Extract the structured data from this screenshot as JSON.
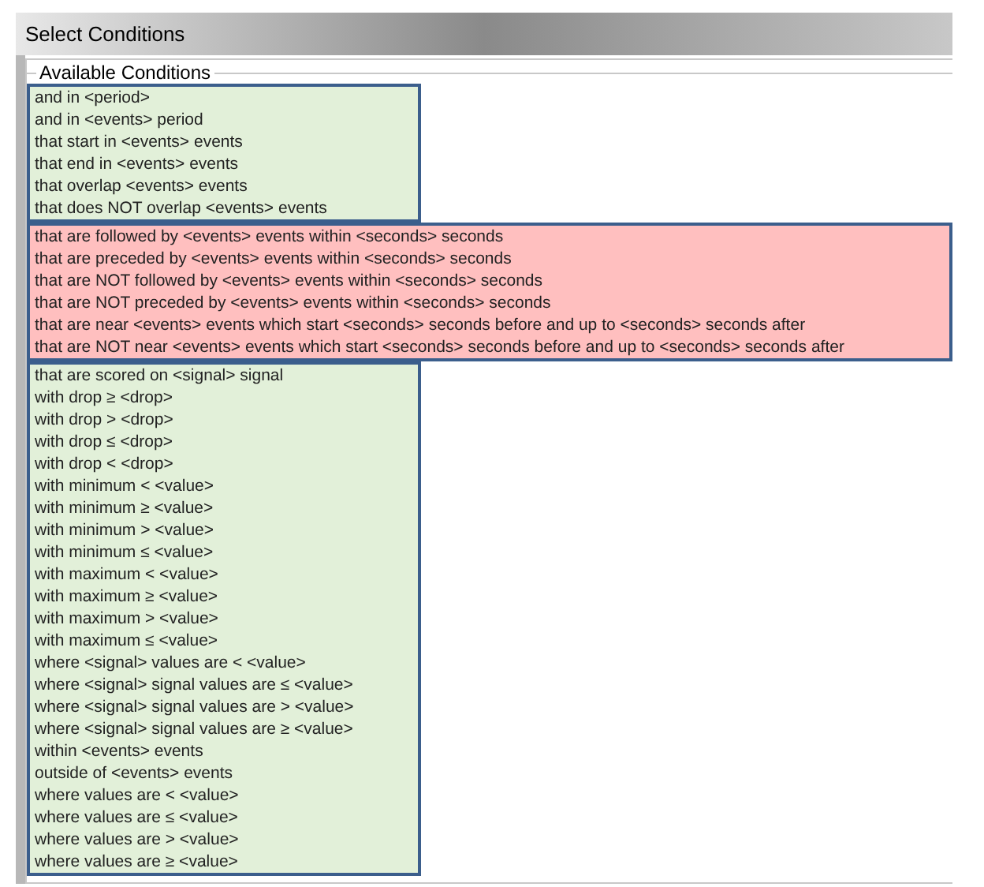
{
  "window": {
    "title": "Select Conditions"
  },
  "group_box": {
    "label": "Available Conditions"
  },
  "groups": [
    {
      "color": "#e2f0d9",
      "wide": false,
      "items": [
        "and in <period>",
        "and in <events> period",
        "that start in <events> events",
        "that end in <events> events",
        "that overlap <events> events",
        "that does NOT overlap <events> events"
      ]
    },
    {
      "color": "#ffbfbf",
      "wide": true,
      "items": [
        "that are followed by <events> events within <seconds> seconds",
        "that are preceded by <events> events within <seconds> seconds",
        "that are NOT followed by <events> events within <seconds> seconds",
        "that are NOT preceded by <events> events within <seconds> seconds",
        "that are near <events> events which start <seconds> seconds before and up to <seconds> seconds after",
        "that are NOT near <events> events which start <seconds> seconds before and up to <seconds> seconds after"
      ]
    },
    {
      "color": "#e2f0d9",
      "wide": false,
      "items": [
        "that are scored on <signal> signal",
        "with drop ≥ <drop>",
        "with drop > <drop>",
        "with drop ≤ <drop>",
        "with drop < <drop>",
        "with minimum < <value>",
        "with minimum ≥ <value>",
        "with minimum > <value>",
        "with minimum ≤ <value>",
        "with maximum < <value>",
        "with maximum ≥ <value>",
        "with maximum > <value>",
        "with maximum ≤ <value>",
        "where <signal> values are < <value>",
        "where <signal> signal values are ≤ <value>",
        "where <signal> signal values are > <value>",
        "where <signal> signal values are ≥ <value>",
        "within <events> events",
        "outside of <events> events",
        "where values are < <value>",
        "where values are ≤ <value>",
        "where values are > <value>",
        "where values are ≥ <value>"
      ]
    }
  ]
}
